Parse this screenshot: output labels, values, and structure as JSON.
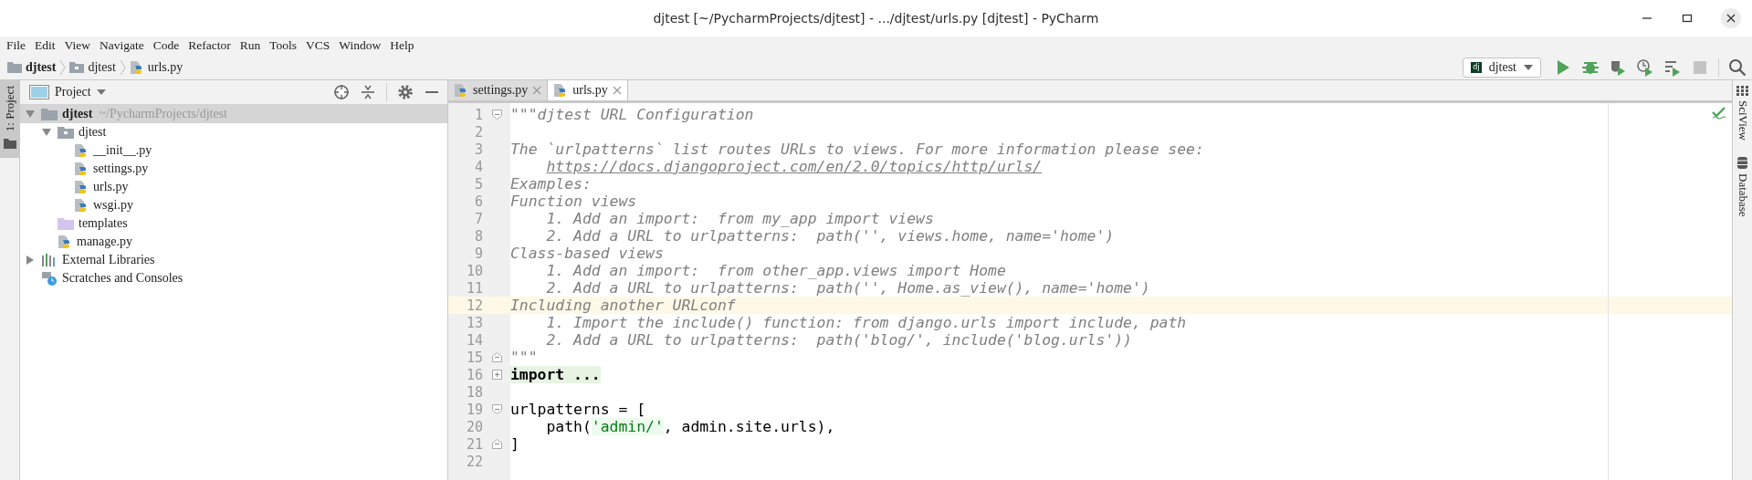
{
  "window": {
    "title": "djtest [~/PycharmProjects/djtest] - .../djtest/urls.py [djtest] - PyCharm"
  },
  "menu": [
    "File",
    "Edit",
    "View",
    "Navigate",
    "Code",
    "Refactor",
    "Run",
    "Tools",
    "VCS",
    "Window",
    "Help"
  ],
  "breadcrumbs": [
    {
      "label": "djtest",
      "kind": "root"
    },
    {
      "label": "djtest",
      "kind": "folder"
    },
    {
      "label": "urls.py",
      "kind": "file"
    }
  ],
  "run_config": {
    "label": "djtest",
    "badge": "dj"
  },
  "toolbar": [
    {
      "kind": "run",
      "disabled": false
    },
    {
      "kind": "debug",
      "disabled": false
    },
    {
      "kind": "coverage",
      "disabled": false
    },
    {
      "kind": "profile",
      "disabled": false
    },
    {
      "kind": "concurrency",
      "disabled": false
    },
    {
      "kind": "stop",
      "disabled": true
    },
    {
      "kind": "search",
      "disabled": false
    }
  ],
  "left_stripe": [
    {
      "label": "1: Project",
      "selected": true
    }
  ],
  "right_stripe": [
    {
      "label": "SciView",
      "kind": "grid"
    },
    {
      "label": "Database",
      "kind": "db"
    }
  ],
  "project_panel": {
    "title": "Project",
    "tree": [
      {
        "label": "djtest",
        "path": "~/PycharmProjects/djtest",
        "kind": "root",
        "expanded": true,
        "selected": true,
        "children": [
          {
            "label": "djtest",
            "kind": "package",
            "expanded": true,
            "selected": false,
            "children": [
              {
                "label": "__init__.py",
                "kind": "python",
                "selected": false
              },
              {
                "label": "settings.py",
                "kind": "python",
                "selected": false
              },
              {
                "label": "urls.py",
                "kind": "python",
                "selected": false
              },
              {
                "label": "wsgi.py",
                "kind": "python",
                "selected": false
              }
            ]
          },
          {
            "label": "templates",
            "kind": "templates",
            "selected": false
          },
          {
            "label": "manage.py",
            "kind": "python",
            "selected": false
          }
        ]
      },
      {
        "label": "External Libraries",
        "kind": "libraries",
        "expanded": false,
        "selected": false
      },
      {
        "label": "Scratches and Consoles",
        "kind": "scratches",
        "selected": false
      }
    ]
  },
  "tabs": [
    {
      "label": "settings.py",
      "selected": false
    },
    {
      "label": "urls.py",
      "selected": true
    }
  ],
  "editor": {
    "lines": [
      {
        "number": "1",
        "kind": "fold_start",
        "selected": false,
        "segments": [
          {
            "kind": "doc",
            "text": "\"\"\"djtest URL Configuration"
          }
        ]
      },
      {
        "number": "2",
        "selected": false
      },
      {
        "number": "3",
        "selected": false,
        "segments": [
          {
            "kind": "doc",
            "text": "The `urlpatterns` list routes URLs to views. For more information please see:"
          }
        ]
      },
      {
        "number": "4",
        "selected": false,
        "segments": [
          {
            "kind": "link",
            "text": "    https://docs.djangoproject.com/en/2.0/topics/http/urls/"
          }
        ]
      },
      {
        "number": "5",
        "selected": false,
        "segments": [
          {
            "kind": "doc",
            "text": "Examples:"
          }
        ]
      },
      {
        "number": "6",
        "selected": false,
        "segments": [
          {
            "kind": "doc",
            "text": "Function views"
          }
        ]
      },
      {
        "number": "7",
        "selected": false,
        "segments": [
          {
            "kind": "doc",
            "text": "    1. Add an import:  from my_app import views"
          }
        ]
      },
      {
        "number": "8",
        "selected": false,
        "segments": [
          {
            "kind": "doc",
            "text": "    2. Add a URL to urlpatterns:  path('', views.home, name='home')"
          }
        ]
      },
      {
        "number": "9",
        "selected": false,
        "segments": [
          {
            "kind": "doc",
            "text": "Class-based views"
          }
        ]
      },
      {
        "number": "10",
        "selected": false,
        "segments": [
          {
            "kind": "doc",
            "text": "    1. Add an import:  from other_app.views import Home"
          }
        ]
      },
      {
        "number": "11",
        "selected": false,
        "segments": [
          {
            "kind": "doc",
            "text": "    2. Add a URL to urlpatterns:  path('', Home.as_view(), name='home')"
          }
        ]
      },
      {
        "number": "12",
        "selected": true,
        "segments": [
          {
            "kind": "doc",
            "text": "Including another URLconf"
          }
        ]
      },
      {
        "number": "13",
        "selected": false,
        "segments": [
          {
            "kind": "doc",
            "text": "    1. Import the include() function: from django.urls import include, path"
          }
        ]
      },
      {
        "number": "14",
        "selected": false,
        "segments": [
          {
            "kind": "doc",
            "text": "    2. Add a URL to urlpatterns:  path('blog/', include('blog.urls'))"
          }
        ]
      },
      {
        "number": "15",
        "kind": "fold_end",
        "selected": false,
        "segments": [
          {
            "kind": "doc",
            "text": "\"\"\""
          }
        ]
      },
      {
        "number": "16",
        "kind": "folded",
        "selected": false,
        "segments": [
          {
            "kind": "folded",
            "text": "import ..."
          }
        ]
      },
      {
        "number": "18",
        "selected": false
      },
      {
        "number": "19",
        "kind": "fold_start",
        "selected": false,
        "segments": [
          {
            "kind": "code",
            "text": "urlpatterns = ["
          }
        ]
      },
      {
        "number": "20",
        "selected": false,
        "segments": [
          {
            "kind": "code",
            "text": "    path("
          },
          {
            "kind": "string",
            "text": "'admin/'"
          },
          {
            "kind": "code",
            "text": ", admin.site.urls),"
          }
        ]
      },
      {
        "number": "21",
        "kind": "fold_end",
        "selected": false,
        "segments": [
          {
            "kind": "code",
            "text": "]"
          }
        ]
      },
      {
        "number": "22",
        "selected": false
      }
    ]
  }
}
